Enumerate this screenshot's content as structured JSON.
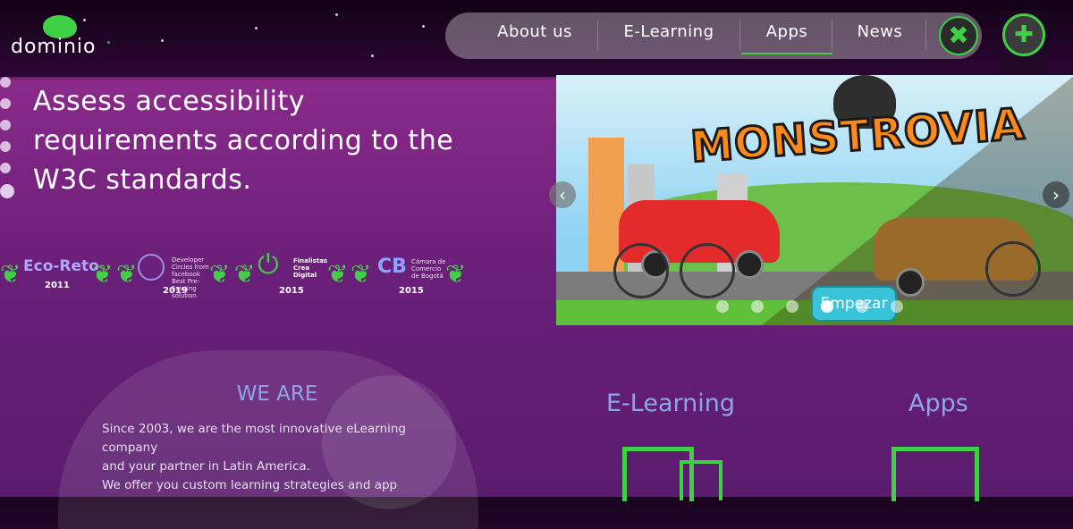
{
  "brand": {
    "logo_text": "dominio",
    "accent": "#3fd046"
  },
  "nav": {
    "items": [
      {
        "label": "About us"
      },
      {
        "label": "E-Learning"
      },
      {
        "label": "Apps"
      },
      {
        "label": "News"
      }
    ],
    "active": "Apps",
    "close_icon": "✖"
  },
  "accessibility": {
    "toggle_icon": "accessibility-person-icon",
    "buttons": [
      {
        "icon": "zoom-out-icon",
        "glyph": "⊖"
      },
      {
        "icon": "zoom-in-icon",
        "glyph": "⊕"
      },
      {
        "icon": "contrast-icon",
        "glyph": "◐"
      },
      {
        "icon": "reset-icon",
        "glyph": "↻"
      }
    ]
  },
  "hero": {
    "headline": "Assess accessibility requirements according to the W3C standards."
  },
  "awards": [
    {
      "title": "Eco-Reto",
      "year": "2011"
    },
    {
      "title": "Developer Circles from facebook Best Pre- Existing solution",
      "year": "2019"
    },
    {
      "title": "Finalistas Crea Digital",
      "year": "2015"
    },
    {
      "title": "Cámara de Comercio de Bogotá",
      "year": "2015"
    }
  ],
  "slider": {
    "title": "MONSTROVIA",
    "start_label": "Empezar",
    "prev_icon": "‹",
    "next_icon": "›",
    "slides_count": 6,
    "active_slide": 3
  },
  "we_are": {
    "heading": "WE ARE",
    "lines": [
      "Since 2003, we are the most innovative eLearning company",
      "and your partner in Latin America.",
      "We offer you custom learning strategies and app"
    ]
  },
  "sections": [
    {
      "title": "E-Learning",
      "icon": "elearning-icon"
    },
    {
      "title": "Apps",
      "icon": "apps-icon"
    }
  ]
}
